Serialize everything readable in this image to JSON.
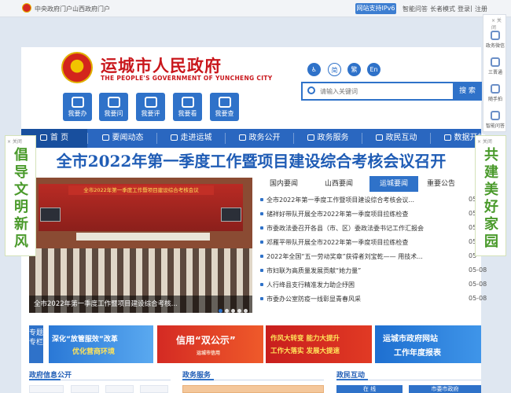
{
  "topbar": {
    "left_links": [
      "中央政府门户",
      "山西政府门户"
    ],
    "ipv6_badge": "网站支持IPv6",
    "right_links": [
      "智能问答",
      "长者模式",
      "登录",
      "注册"
    ]
  },
  "header": {
    "site_name_cn": "运城市人民政府",
    "site_name_en": "THE PEOPLE'S GOVERNMENT OF YUNCHENG  CITY",
    "quick_buttons": [
      "我要办",
      "我要问",
      "我要评",
      "我要看",
      "我要查"
    ],
    "lang_buttons": [
      "简",
      "繁",
      "En"
    ],
    "search_placeholder": "请输入关键词",
    "search_button": "搜 索"
  },
  "nav": {
    "items": [
      "首 页",
      "要闻动态",
      "走进运城",
      "政务公开",
      "政务服务",
      "政民互动",
      "数据开放"
    ]
  },
  "headline": "全市2022年第一季度工作暨项目建设综合考核会议召开",
  "photo": {
    "banner_text": "全市2022年第一季度工作暨项目建设综合考核会议",
    "caption": "全市2022年第一季度工作暨项目建设综合考核..."
  },
  "news": {
    "tabs": [
      "国内要闻",
      "山西要闻",
      "运城要闻",
      "重要公告"
    ],
    "active_tab": "运城要闻",
    "items": [
      {
        "title": "全市2022年第一季度工作暨项目建设综合考核会议...",
        "date": "05"
      },
      {
        "title": "储祥好带队开展全市2022年第一季度项目拉练检查",
        "date": "05"
      },
      {
        "title": "市委政法委召开各县（市、区）委政法委书记工作汇报会",
        "date": "05"
      },
      {
        "title": "邓雁平带队开展全市2022年第一季度项目拉练检查",
        "date": "05"
      },
      {
        "title": "2022年全国“五一劳动奖章”获得者刘宝乾—— 用技术...",
        "date": "05"
      },
      {
        "title": "市妇联为高质量发展贡献“她力量”",
        "date": "05-08"
      },
      {
        "title": "人行绛县支行精准发力助企纾困",
        "date": "05-08"
      },
      {
        "title": "市委办公室防疫一线彰显青春风采",
        "date": "05-08"
      }
    ]
  },
  "side_left": {
    "close": "× 关闭",
    "text": "倡导文明新风"
  },
  "side_right": {
    "close": "× 关闭",
    "text": "共建美好家园"
  },
  "right_panel": {
    "close": "× 关闭",
    "items": [
      "政务微信",
      "三晋通",
      "随手拍",
      "智能问答"
    ]
  },
  "zt_label": "专题专栏",
  "banners": [
    {
      "line1": "深化“放管服效”改革",
      "line2": "优化营商环境"
    },
    {
      "line1": "信用“双公示”",
      "line2": "运城市信用"
    },
    {
      "line1": "作风大转变 能力大提升",
      "line2": "工作大落实 发展大提速"
    },
    {
      "line1": "运城市政府网站",
      "line2": "工作年度报表"
    }
  ],
  "sections": [
    "政府信息公开",
    "政务服务",
    "政民互动"
  ],
  "bottom_boxes": [
    "在 线",
    "市委市政府"
  ],
  "colors": {
    "primary": "#2f72c9",
    "nav": "#2a67c0",
    "red": "#c9171c",
    "green": "#4a9a2b"
  }
}
